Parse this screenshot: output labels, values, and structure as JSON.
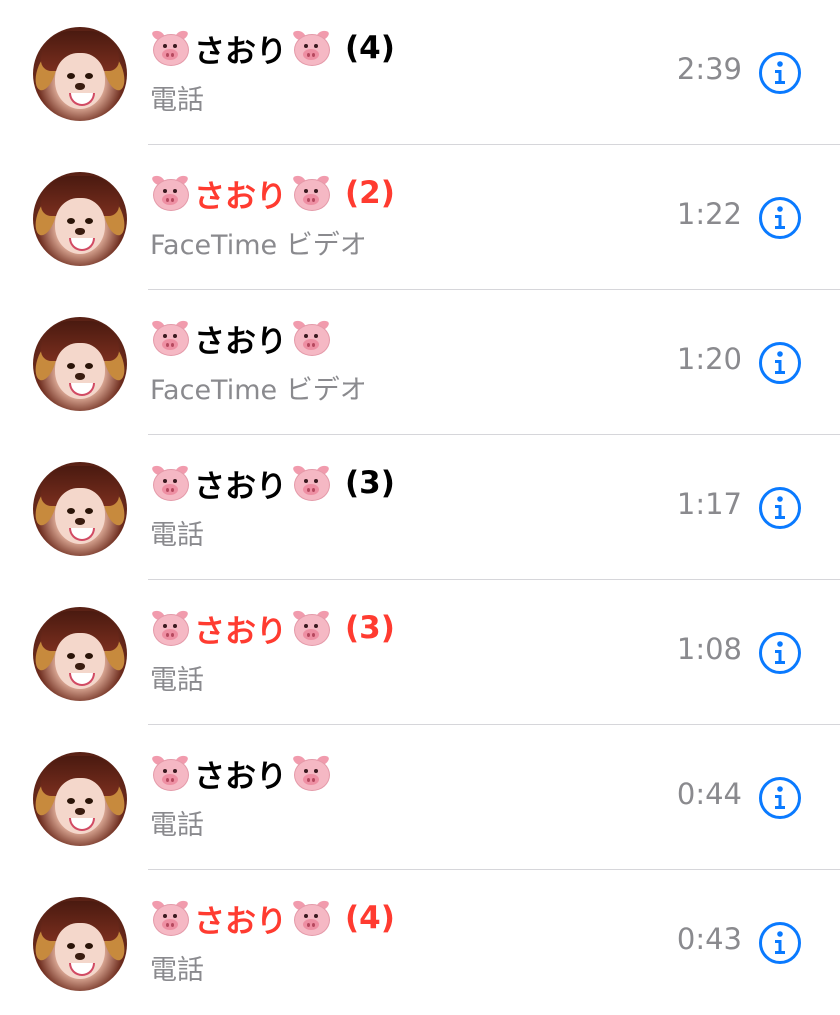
{
  "colors": {
    "accent": "#0a7aff",
    "missed": "#ff3b30",
    "secondary_text": "#8a8a8e",
    "divider": "#d6d6da"
  },
  "icons": {
    "avatar": "contact-photo-icon",
    "name_decoration": "pig-face-emoji",
    "info": "info-circle-icon"
  },
  "calls": [
    {
      "name": "さおり",
      "count": "(4)",
      "type": "電話",
      "time": "2:39",
      "missed": false
    },
    {
      "name": "さおり",
      "count": "(2)",
      "type": "FaceTime ビデオ",
      "time": "1:22",
      "missed": true
    },
    {
      "name": "さおり",
      "count": "",
      "type": "FaceTime ビデオ",
      "time": "1:20",
      "missed": false
    },
    {
      "name": "さおり",
      "count": "(3)",
      "type": "電話",
      "time": "1:17",
      "missed": false
    },
    {
      "name": "さおり",
      "count": "(3)",
      "type": "電話",
      "time": "1:08",
      "missed": true
    },
    {
      "name": "さおり",
      "count": "",
      "type": "電話",
      "time": "0:44",
      "missed": false
    },
    {
      "name": "さおり",
      "count": "(4)",
      "type": "電話",
      "time": "0:43",
      "missed": true
    }
  ]
}
